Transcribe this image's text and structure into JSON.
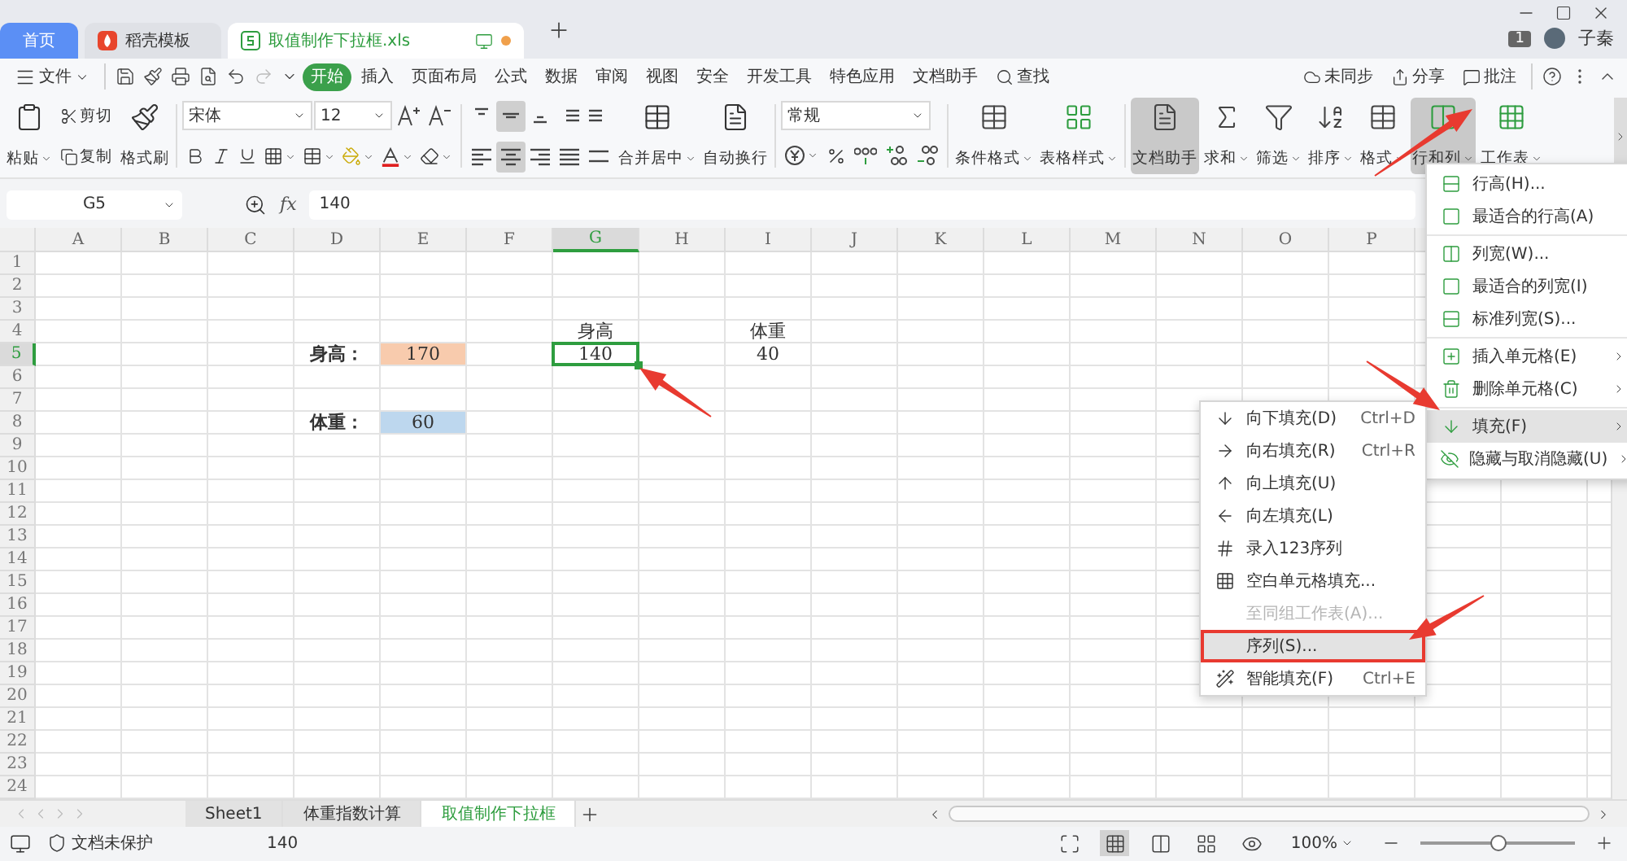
{
  "tabs": [
    {
      "label": "首页",
      "kind": "home",
      "selected": false
    },
    {
      "label": "稻壳模板",
      "kind": "docer",
      "selected": false
    },
    {
      "label": "取值制作下拉框.xls",
      "kind": "file",
      "selected": true,
      "unsaved": true
    }
  ],
  "account": {
    "badge": "1",
    "name": "子秦"
  },
  "menu_bar": {
    "file": "文件",
    "tabs": [
      {
        "label": "开始",
        "selected": true
      },
      {
        "label": "插入",
        "selected": false
      },
      {
        "label": "页面布局",
        "selected": false
      },
      {
        "label": "公式",
        "selected": false
      },
      {
        "label": "数据",
        "selected": false
      },
      {
        "label": "审阅",
        "selected": false
      },
      {
        "label": "视图",
        "selected": false
      },
      {
        "label": "安全",
        "selected": false
      },
      {
        "label": "开发工具",
        "selected": false
      },
      {
        "label": "特色应用",
        "selected": false
      },
      {
        "label": "文档助手",
        "selected": false
      }
    ],
    "search": "查找",
    "actions": [
      {
        "label": "未同步",
        "kind": "sync"
      },
      {
        "label": "分享",
        "kind": "share"
      },
      {
        "label": "批注",
        "kind": "comment"
      }
    ]
  },
  "ribbon": {
    "paste": "粘贴",
    "cut": "剪切",
    "copy": "复制",
    "format_painter": "格式刷",
    "font": "宋体",
    "font_size": "12",
    "alignment": [
      {
        "kind": "top",
        "pressed": false
      },
      {
        "kind": "middle",
        "pressed": true
      },
      {
        "kind": "bottom",
        "pressed": false
      },
      {
        "kind": "outdent",
        "pressed": false
      },
      {
        "kind": "indent",
        "pressed": false
      },
      {
        "kind": "left",
        "pressed": false
      },
      {
        "kind": "center",
        "pressed": true
      },
      {
        "kind": "right",
        "pressed": false
      },
      {
        "kind": "justify",
        "pressed": false
      },
      {
        "kind": "distribute",
        "pressed": false
      }
    ],
    "merge": "合并居中",
    "wrap": "自动换行",
    "number_format": "常规",
    "tools": [
      {
        "label": "条件格式",
        "kind": "conditional",
        "pressed": false
      },
      {
        "label": "表格样式",
        "kind": "table_style",
        "pressed": false
      },
      {
        "label": "文档助手",
        "kind": "assistant",
        "pressed": true
      },
      {
        "label": "求和",
        "kind": "sum",
        "pressed": false
      },
      {
        "label": "筛选",
        "kind": "filter",
        "pressed": false
      },
      {
        "label": "排序",
        "kind": "sort",
        "pressed": false
      },
      {
        "label": "格式",
        "kind": "format",
        "pressed": false
      },
      {
        "label": "行和列",
        "kind": "rows_cols",
        "pressed": true
      },
      {
        "label": "工作表",
        "kind": "sheet",
        "pressed": false
      }
    ]
  },
  "formula_bar": {
    "cell": "G5",
    "fx": "fx",
    "value": "140"
  },
  "sheet": {
    "columns": [
      "A",
      "B",
      "C",
      "D",
      "E",
      "F",
      "G",
      "H",
      "I",
      "J",
      "K",
      "L",
      "M",
      "N",
      "O",
      "P"
    ],
    "rows": [
      {
        "number": "1"
      },
      {
        "number": "2"
      },
      {
        "number": "3"
      },
      {
        "number": "4",
        "cells": [
          null,
          null,
          null,
          null,
          null,
          null,
          {
            "text": "身高",
            "bold": false,
            "selected": false
          },
          null,
          {
            "text": "体重",
            "bold": false,
            "selected": false
          }
        ]
      },
      {
        "number": "5",
        "cells": [
          null,
          null,
          null,
          {
            "text": "身高：",
            "bold": true,
            "selected": false
          },
          {
            "text": "170",
            "bold": false,
            "selected": false,
            "color": "#f8cbad"
          },
          null,
          {
            "text": "140",
            "bold": false,
            "selected": true
          },
          null,
          {
            "text": "40",
            "bold": false,
            "selected": false
          }
        ]
      },
      {
        "number": "6"
      },
      {
        "number": "7"
      },
      {
        "number": "8",
        "cells": [
          null,
          null,
          null,
          {
            "text": "体重：",
            "bold": true,
            "selected": false
          },
          {
            "text": "60",
            "bold": false,
            "selected": false,
            "color": "#bdd7ee"
          }
        ]
      },
      {
        "number": "9"
      },
      {
        "number": "10"
      },
      {
        "number": "11"
      },
      {
        "number": "12"
      },
      {
        "number": "13"
      },
      {
        "number": "14"
      },
      {
        "number": "15"
      },
      {
        "number": "16"
      },
      {
        "number": "17"
      },
      {
        "number": "18"
      },
      {
        "number": "19"
      },
      {
        "number": "20"
      },
      {
        "number": "21"
      },
      {
        "number": "22"
      },
      {
        "number": "23"
      },
      {
        "number": "24"
      }
    ]
  },
  "context_menu": {
    "groups": [
      [
        {
          "label": "行高(H)...",
          "kind": "row_height",
          "submenu": false,
          "highlighted": false
        },
        {
          "label": "最适合的行高(A)",
          "kind": "fit",
          "submenu": false,
          "highlighted": false
        }
      ],
      [
        {
          "label": "列宽(W)...",
          "kind": "col_width",
          "submenu": false,
          "highlighted": false
        },
        {
          "label": "最适合的列宽(I)",
          "kind": "fit",
          "submenu": false,
          "highlighted": false
        },
        {
          "label": "标准列宽(S)...",
          "kind": "std_width",
          "submenu": false,
          "highlighted": false
        }
      ],
      [
        {
          "label": "插入单元格(E)",
          "kind": "insert",
          "submenu": true,
          "highlighted": false
        },
        {
          "label": "删除单元格(C)",
          "kind": "delete",
          "submenu": true,
          "highlighted": false
        }
      ],
      [
        {
          "label": "填充(F)",
          "kind": "fill_down",
          "submenu": true,
          "highlighted": true
        },
        {
          "label": "隐藏与取消隐藏(U)",
          "kind": "hide",
          "submenu": true,
          "highlighted": false
        }
      ]
    ]
  },
  "fill_submenu": {
    "items": [
      {
        "label": "向下填充(D)",
        "shortcut": "Ctrl+D",
        "kind": "fill_down",
        "disabled": false,
        "selected": false
      },
      {
        "label": "向右填充(R)",
        "shortcut": "Ctrl+R",
        "kind": "fill_right",
        "disabled": false,
        "selected": false
      },
      {
        "label": "向上填充(U)",
        "kind": "fill_up",
        "disabled": false,
        "selected": false
      },
      {
        "label": "向左填充(L)",
        "kind": "fill_left",
        "disabled": false,
        "selected": false
      },
      {
        "label": "录入123序列",
        "kind": "sequence",
        "disabled": false,
        "selected": false
      },
      {
        "label": "空白单元格填充...",
        "kind": "blank",
        "disabled": false,
        "selected": false
      },
      {
        "label": "至同组工作表(A)...",
        "kind": "none",
        "disabled": true,
        "selected": false
      },
      {
        "label": "序列(S)...",
        "kind": "none",
        "disabled": false,
        "selected": true
      },
      {
        "label": "智能填充(F)",
        "shortcut": "Ctrl+E",
        "kind": "smart",
        "disabled": false,
        "selected": false
      }
    ]
  },
  "annotations": [
    {
      "kind": "arrow"
    },
    {
      "kind": "arrow"
    },
    {
      "kind": "arrow"
    },
    {
      "kind": "arrow"
    }
  ],
  "sheet_tabs": [
    {
      "label": "Sheet1",
      "selected": false
    },
    {
      "label": "体重指数计算",
      "selected": false
    },
    {
      "label": "取值制作下拉框",
      "selected": true
    }
  ],
  "status_bar": {
    "protection": "文档未保护",
    "value": "140",
    "views": [
      {
        "kind": "fullscreen",
        "selected": false
      },
      {
        "kind": "normal",
        "selected": true
      },
      {
        "kind": "page",
        "selected": false
      },
      {
        "kind": "layout",
        "selected": false
      },
      {
        "kind": "reading",
        "selected": false
      }
    ],
    "zoom": "100%",
    "level": 0.5
  }
}
